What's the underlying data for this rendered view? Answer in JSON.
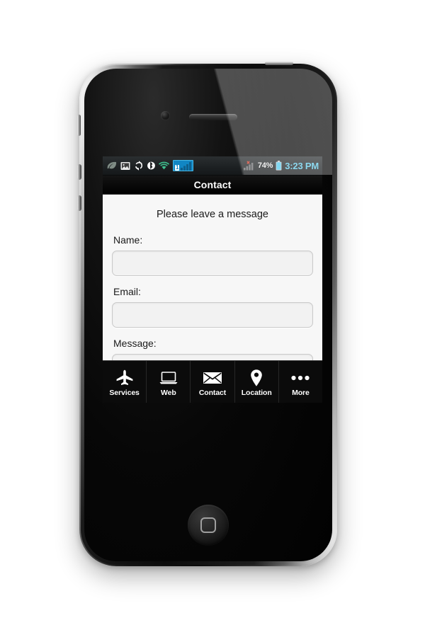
{
  "device": {
    "hardware": {
      "camera": "front-camera",
      "earpiece": "earpiece-speaker",
      "home_button": "home-button",
      "mute_switch": "mute-switch",
      "volume_up": "volume-up-button",
      "volume_down": "volume-down-button",
      "power": "power-button"
    }
  },
  "statusbar": {
    "left_icons": [
      {
        "name": "leaf-icon"
      },
      {
        "name": "gallery-image-icon"
      },
      {
        "name": "sync-icon"
      },
      {
        "name": "bluetooth-icon"
      },
      {
        "name": "wifi-icon"
      }
    ],
    "sim_slot_badge": "1",
    "right_icons": [
      {
        "name": "mobile-signal-error-icon"
      }
    ],
    "battery_percent": "74%",
    "clock": "3:23 PM",
    "clock_color": "#5fc8e8",
    "accent_color": "#1186c4"
  },
  "titlebar": {
    "title": "Contact"
  },
  "content": {
    "headline": "Please leave a message",
    "fields": [
      {
        "label": "Name:",
        "value": "",
        "placeholder": ""
      },
      {
        "label": "Email:",
        "value": "",
        "placeholder": ""
      },
      {
        "label": "Message:",
        "value": "",
        "placeholder": ""
      }
    ]
  },
  "tabbar": {
    "items": [
      {
        "label": "Services",
        "icon": "airplane-icon"
      },
      {
        "label": "Web",
        "icon": "laptop-icon"
      },
      {
        "label": "Contact",
        "icon": "envelope-icon"
      },
      {
        "label": "Location",
        "icon": "map-pin-icon"
      },
      {
        "label": "More",
        "icon": "ellipsis-icon"
      }
    ]
  }
}
